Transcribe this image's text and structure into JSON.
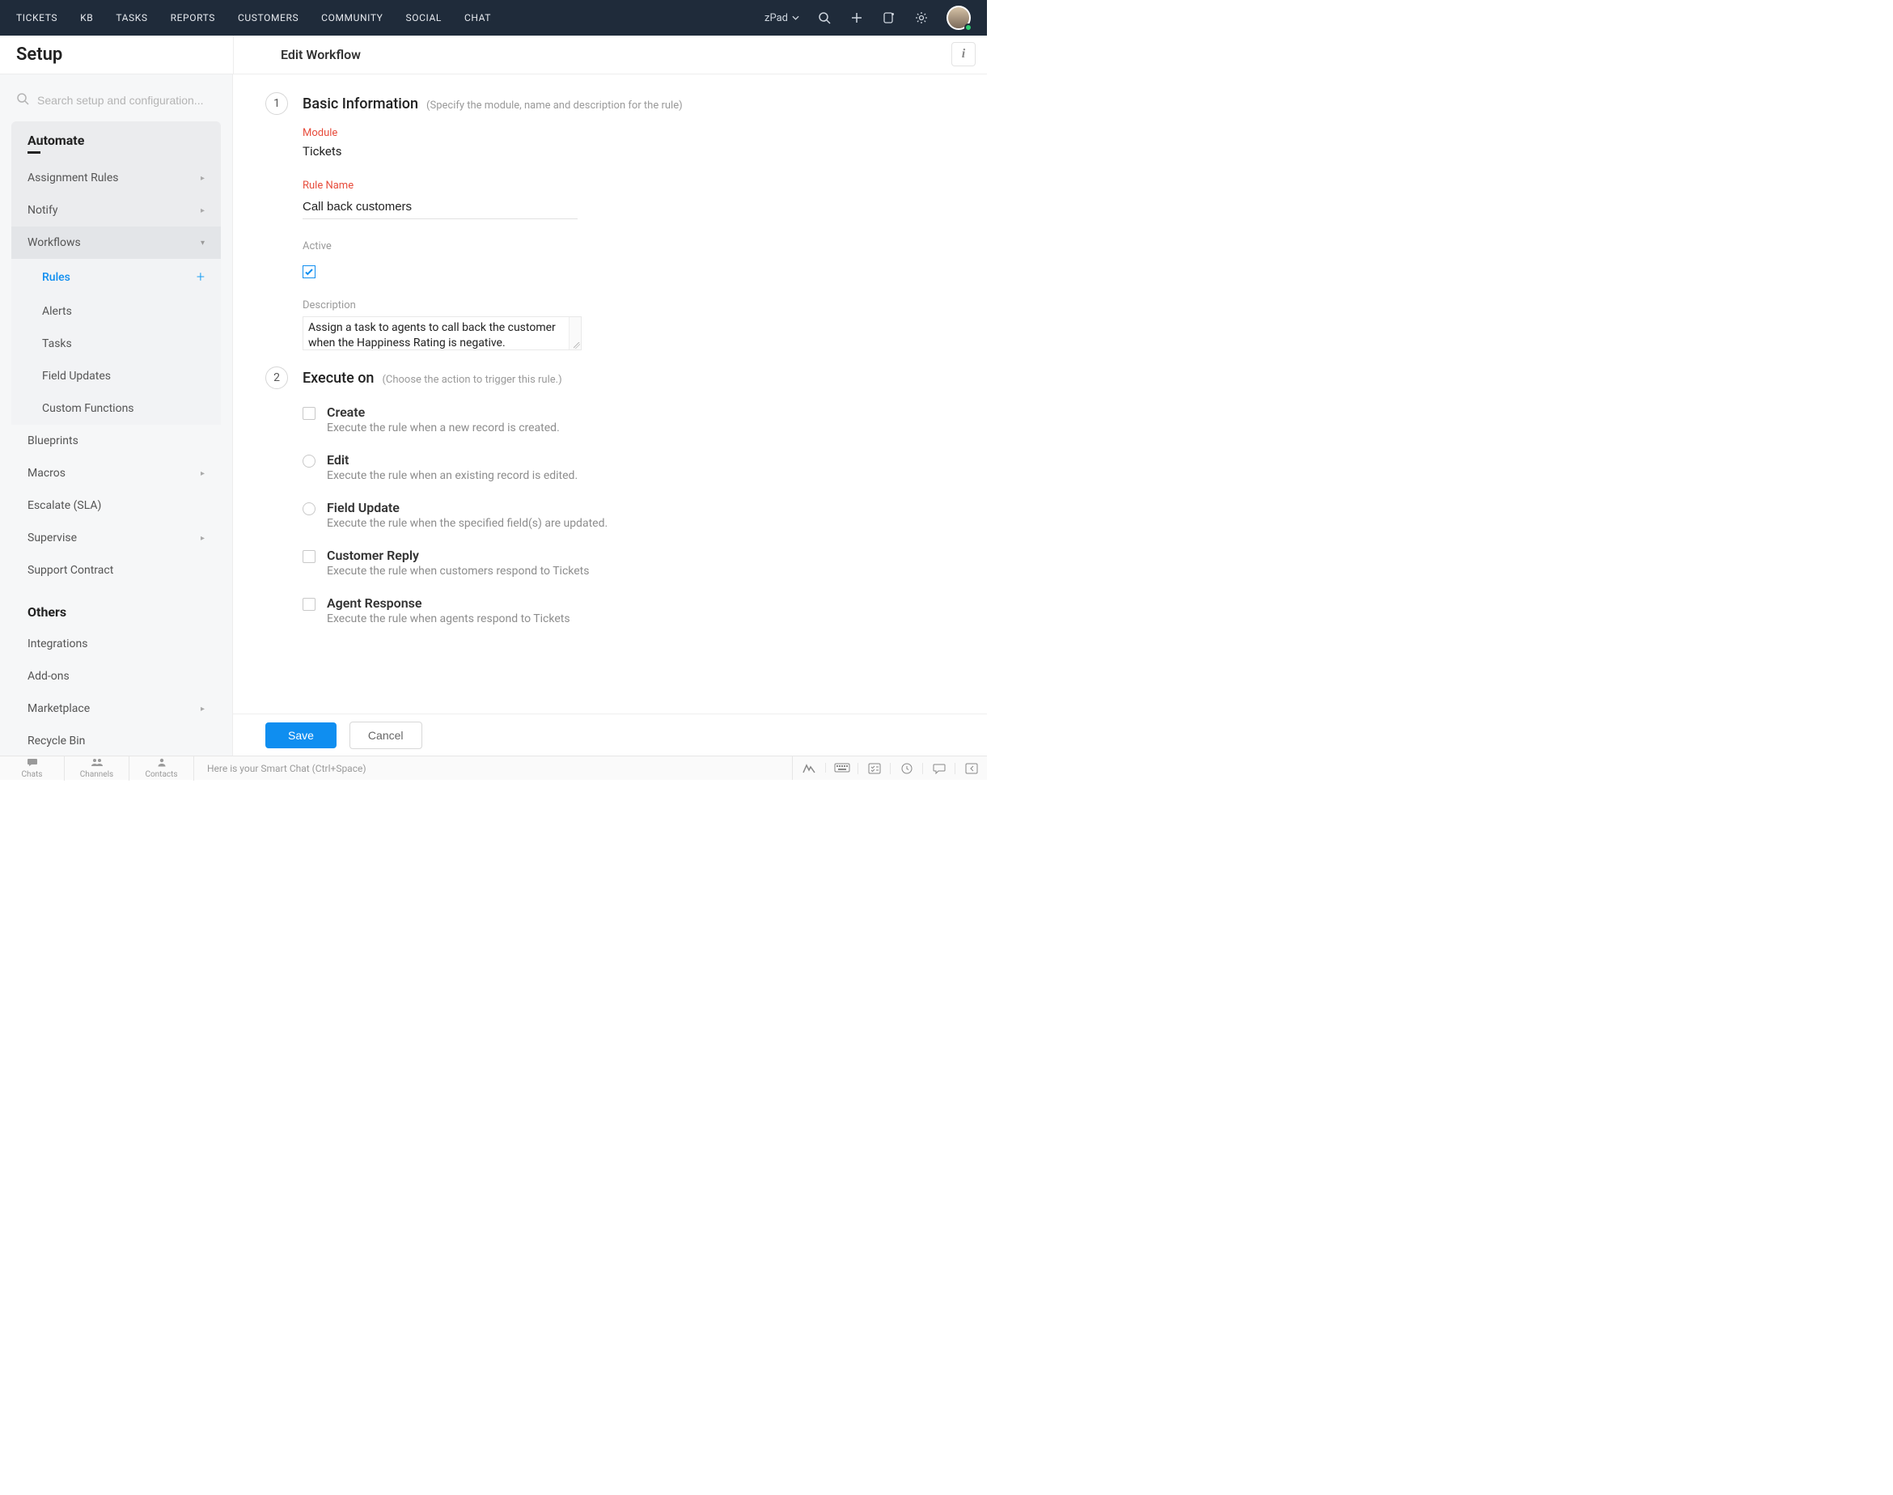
{
  "topnav": {
    "items": [
      "TICKETS",
      "KB",
      "TASKS",
      "REPORTS",
      "CUSTOMERS",
      "COMMUNITY",
      "SOCIAL",
      "CHAT"
    ],
    "org_name": "zPad"
  },
  "page": {
    "setup_title": "Setup",
    "workflow_title": "Edit Workflow"
  },
  "search": {
    "placeholder": "Search setup and configuration..."
  },
  "sidebar": {
    "automate": {
      "heading": "Automate",
      "items": {
        "assignment": "Assignment Rules",
        "notify": "Notify",
        "workflows": "Workflows",
        "workflows_sub": {
          "rules": "Rules",
          "alerts": "Alerts",
          "tasks": "Tasks",
          "field_updates": "Field Updates",
          "custom_functions": "Custom Functions"
        },
        "blueprints": "Blueprints",
        "macros": "Macros",
        "escalate": "Escalate (SLA)",
        "supervise": "Supervise",
        "support_contract": "Support Contract"
      }
    },
    "others": {
      "heading": "Others",
      "items": {
        "integrations": "Integrations",
        "addons": "Add-ons",
        "marketplace": "Marketplace",
        "recycle": "Recycle Bin"
      }
    }
  },
  "basic": {
    "step": "1",
    "title": "Basic Information",
    "hint": "(Specify the module, name and description for the rule)",
    "module_label": "Module",
    "module_value": "Tickets",
    "rule_name_label": "Rule Name",
    "rule_name_value": "Call back customers",
    "active_label": "Active",
    "description_label": "Description",
    "description_value": "Assign a task to agents to call back the customer when the Happiness Rating is negative."
  },
  "execute": {
    "step": "2",
    "title": "Execute on",
    "hint": "(Choose the action to trigger this rule.)",
    "options": [
      {
        "key": "create",
        "control": "checkbox",
        "title": "Create",
        "desc": "Execute the rule when a new record is created."
      },
      {
        "key": "edit",
        "control": "radio",
        "title": "Edit",
        "desc": "Execute the rule when an existing record is edited."
      },
      {
        "key": "field_update",
        "control": "radio",
        "title": "Field Update",
        "desc": "Execute the rule when the specified field(s) are updated."
      },
      {
        "key": "customer_reply",
        "control": "checkbox",
        "title": "Customer Reply",
        "desc": "Execute the rule when customers respond to Tickets"
      },
      {
        "key": "agent_response",
        "control": "checkbox",
        "title": "Agent Response",
        "desc": "Execute the rule when agents respond to Tickets"
      }
    ]
  },
  "actions": {
    "save": "Save",
    "cancel": "Cancel"
  },
  "chatbar": {
    "tabs": {
      "chats": "Chats",
      "channels": "Channels",
      "contacts": "Contacts"
    },
    "smart": "Here is your Smart Chat (Ctrl+Space)"
  }
}
